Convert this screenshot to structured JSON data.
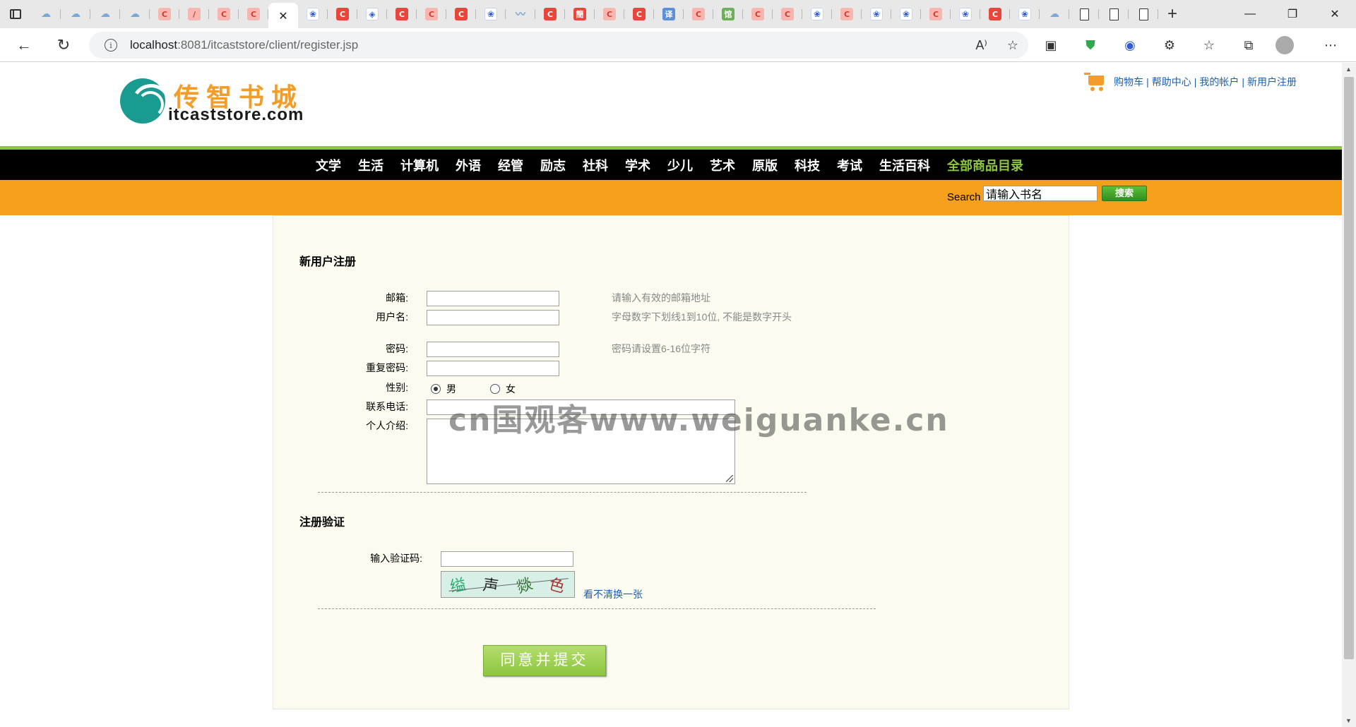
{
  "browser": {
    "url_host": "localhost",
    "url_path": ":8081/itcaststore/client/register.jsp",
    "tabs": [
      "cloud",
      "cloud",
      "cloud",
      "cloud",
      "c-light",
      "pen",
      "c-light",
      "c-light",
      "close",
      "paw",
      "c",
      "baidu-pan",
      "c",
      "c-light",
      "c",
      "paw",
      "feather",
      "c",
      "jian",
      "c-light",
      "c",
      "yi",
      "c-light",
      "guan",
      "c-light",
      "c-light",
      "paw",
      "c-light",
      "paw",
      "paw",
      "c-light",
      "paw",
      "c",
      "paw",
      "cloud",
      "doc",
      "doc",
      "doc"
    ],
    "tab_glyphs": {
      "jian": "簡",
      "yi": "译",
      "guan": "馆",
      "pen": "/"
    },
    "new_tab_label": "+",
    "window_controls": [
      "—",
      "❐",
      "✕"
    ]
  },
  "header": {
    "logo_cn": "传智书城",
    "logo_en": "itcaststore.com",
    "links": [
      "购物车",
      "帮助中心",
      "我的帐户",
      "新用户注册"
    ]
  },
  "nav": {
    "items": [
      "文学",
      "生活",
      "计算机",
      "外语",
      "经管",
      "励志",
      "社科",
      "学术",
      "少儿",
      "艺术",
      "原版",
      "科技",
      "考试",
      "生活百科"
    ],
    "all_label": "全部商品目录"
  },
  "search": {
    "label": "Search",
    "input_value": "请输入书名",
    "button_label": "搜索"
  },
  "register": {
    "title": "新用户注册",
    "fields": {
      "email_label": "邮箱:",
      "username_label": "用户名:",
      "password_label": "密码:",
      "repassword_label": "重复密码:",
      "gender_label": "性别:",
      "phone_label": "联系电话:",
      "intro_label": "个人介绍:"
    },
    "hints": {
      "email": "请输入有效的邮箱地址",
      "username": "字母数字下划线1到10位, 不能是数字开头",
      "password": "密码请设置6-16位字符"
    },
    "gender_options": [
      "男",
      "女"
    ],
    "gender_selected": "男"
  },
  "verify": {
    "title": "注册验证",
    "code_label": "输入验证码:",
    "captcha_chars": [
      "缢",
      "声",
      "燚",
      "色"
    ],
    "refresh_label": "看不清换一张"
  },
  "submit_label": "同意并提交",
  "watermark": "cn国观客www.weiguanke.cn",
  "colors": {
    "accent_green": "#8cc63f",
    "nav_bg": "#000000",
    "search_bar_bg": "#f5a01c",
    "logo_orange": "#f39c28",
    "logo_teal": "#1a9b8f",
    "link_blue": "#1a5fb4",
    "panel_bg": "#fbfbf0"
  }
}
